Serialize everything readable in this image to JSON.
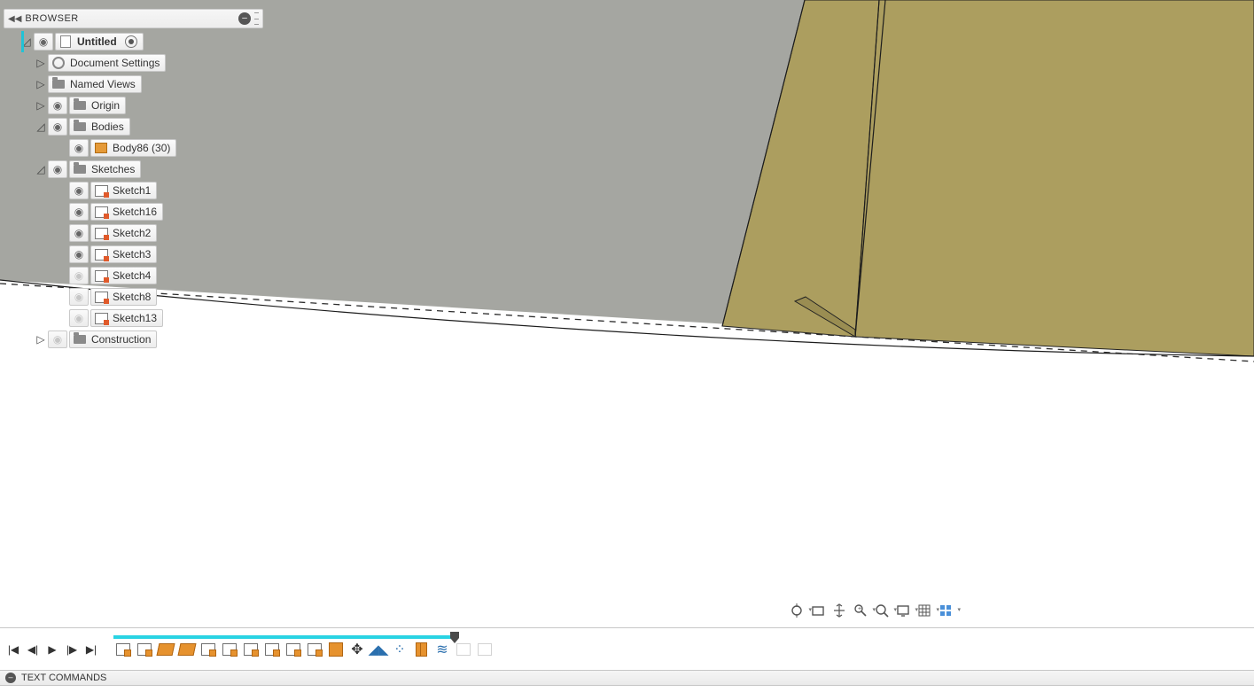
{
  "browser": {
    "title": "BROWSER",
    "root": {
      "label": "Untitled"
    },
    "docSettings": "Document Settings",
    "namedViews": "Named Views",
    "origin": "Origin",
    "bodies": "Bodies",
    "body1": "Body86 (30)",
    "sketches": "Sketches",
    "sketchItems": [
      {
        "label": "Sketch1",
        "visible": true
      },
      {
        "label": "Sketch16",
        "visible": true
      },
      {
        "label": "Sketch2",
        "visible": true
      },
      {
        "label": "Sketch3",
        "visible": true
      },
      {
        "label": "Sketch4",
        "visible": false
      },
      {
        "label": "Sketch8",
        "visible": false
      },
      {
        "label": "Sketch13",
        "visible": false
      }
    ],
    "construction": "Construction"
  },
  "navbar": {
    "items": [
      "orbit",
      "lookat",
      "pan",
      "zoom",
      "zoom-window",
      "display",
      "grid",
      "viewports"
    ]
  },
  "timeline": {
    "features": [
      {
        "t": "sk"
      },
      {
        "t": "sk"
      },
      {
        "t": "surf"
      },
      {
        "t": "surf"
      },
      {
        "t": "sk"
      },
      {
        "t": "sk"
      },
      {
        "t": "sk"
      },
      {
        "t": "sk"
      },
      {
        "t": "sk"
      },
      {
        "t": "sk"
      },
      {
        "t": "ext"
      },
      {
        "t": "move"
      },
      {
        "t": "mirror"
      },
      {
        "t": "pattern"
      },
      {
        "t": "combine"
      },
      {
        "t": "shell"
      },
      {
        "t": "dim"
      },
      {
        "t": "dim"
      }
    ]
  },
  "textCommands": {
    "title": "TEXT COMMANDS"
  }
}
